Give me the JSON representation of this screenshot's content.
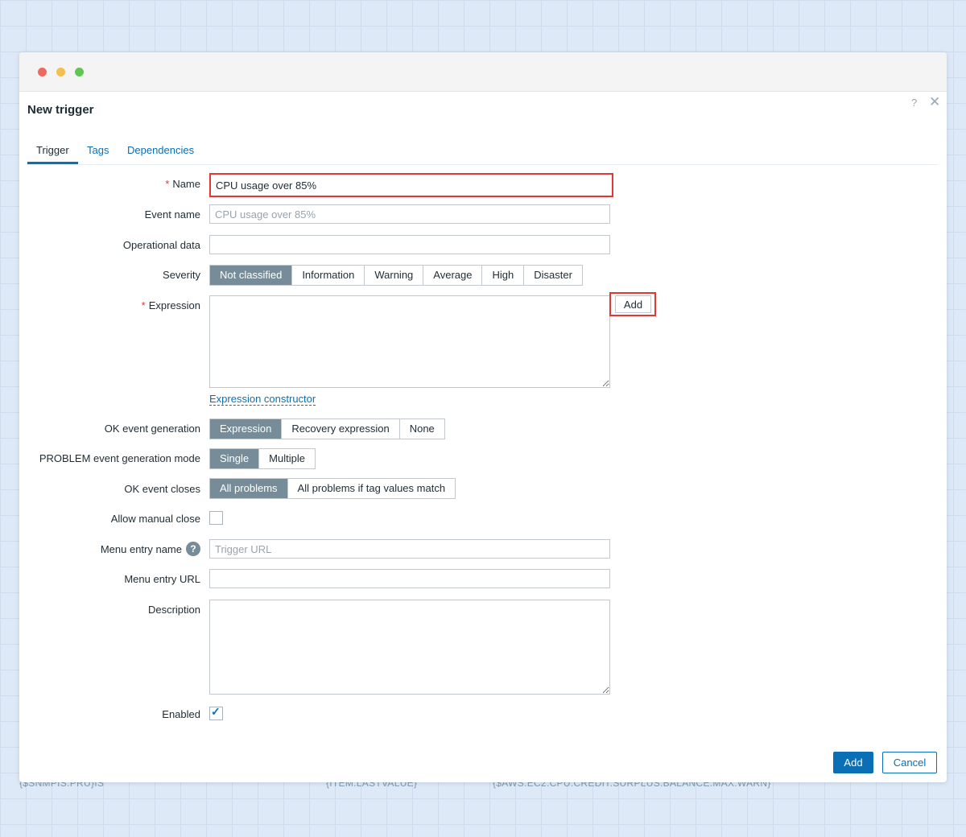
{
  "background": {
    "texts": [
      "{$SNMPIS.PRU}IS",
      "{ITEM.LASTVALUE}",
      "{$AWS.EC2.CPU.CREDIT.SURPLUS.BALANCE.MAX.WARN}"
    ]
  },
  "dialog": {
    "title": "New trigger",
    "help_icon": "?",
    "close_icon": "✕"
  },
  "tabs": [
    {
      "label": "Trigger",
      "active": true
    },
    {
      "label": "Tags",
      "active": false
    },
    {
      "label": "Dependencies",
      "active": false
    }
  ],
  "form": {
    "name": {
      "label": "Name",
      "required_mark": "*",
      "value": "CPU usage over 85%"
    },
    "event_name": {
      "label": "Event name",
      "placeholder": "CPU usage over 85%",
      "value": ""
    },
    "operational_data": {
      "label": "Operational data",
      "value": ""
    },
    "severity": {
      "label": "Severity",
      "options": [
        "Not classified",
        "Information",
        "Warning",
        "Average",
        "High",
        "Disaster"
      ],
      "selected": "Not classified"
    },
    "expression": {
      "label": "Expression",
      "required_mark": "*",
      "value": "",
      "add_label": "Add",
      "constructor_link": "Expression constructor"
    },
    "ok_event_generation": {
      "label": "OK event generation",
      "options": [
        "Expression",
        "Recovery expression",
        "None"
      ],
      "selected": "Expression"
    },
    "problem_mode": {
      "label": "PROBLEM event generation mode",
      "options": [
        "Single",
        "Multiple"
      ],
      "selected": "Single"
    },
    "ok_event_closes": {
      "label": "OK event closes",
      "options": [
        "All problems",
        "All problems if tag values match"
      ],
      "selected": "All problems"
    },
    "allow_manual_close": {
      "label": "Allow manual close",
      "checked": false
    },
    "menu_entry_name": {
      "label": "Menu entry name",
      "placeholder": "Trigger URL",
      "help": "?"
    },
    "menu_entry_url": {
      "label": "Menu entry URL",
      "value": ""
    },
    "description": {
      "label": "Description",
      "value": ""
    },
    "enabled": {
      "label": "Enabled",
      "checked": true,
      "check_glyph": "✓"
    }
  },
  "footer": {
    "add_label": "Add",
    "cancel_label": "Cancel"
  },
  "colors": {
    "accent": "#0b6fb5",
    "selected_segment": "#768d99",
    "highlight_border": "#e33734"
  }
}
